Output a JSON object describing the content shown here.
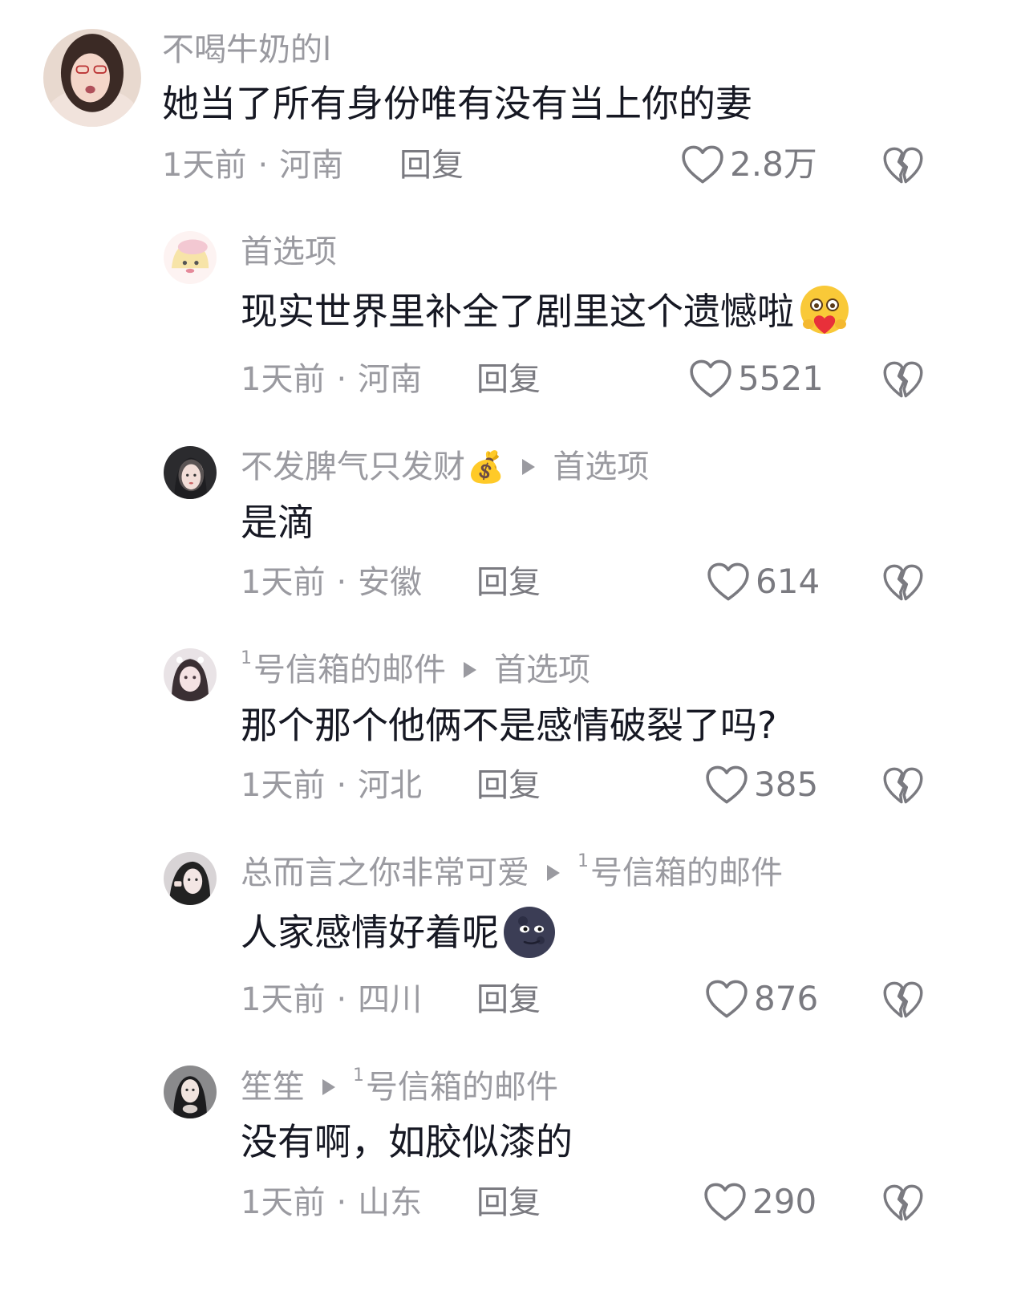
{
  "comments": [
    {
      "username": "不喝牛奶的l",
      "text": "她当了所有身份唯有没有当上你的妻",
      "time": "1天前",
      "dot": "·",
      "location": "河南",
      "reply_label": "回复",
      "likes": "2.8万"
    },
    {
      "username": "首选项",
      "text": "现实世界里补全了剧里这个遗憾啦",
      "text_emoji": "hugging-face-emoji",
      "time": "1天前",
      "dot": "·",
      "location": "河南",
      "reply_label": "回复",
      "likes": "5521"
    },
    {
      "username": "不发脾气只发财",
      "username_emoji": "💰",
      "reply_to": "首选项",
      "text": "是滴",
      "time": "1天前",
      "dot": "·",
      "location": "安徽",
      "reply_label": "回复",
      "likes": "614"
    },
    {
      "username_sup": "1",
      "username": "号信箱的邮件",
      "reply_to": "首选项",
      "text": "那个那个他俩不是感情破裂了吗?",
      "time": "1天前",
      "dot": "·",
      "location": "河北",
      "reply_label": "回复",
      "likes": "385"
    },
    {
      "username": "总而言之你非常可爱",
      "reply_to_sup": "1",
      "reply_to": "号信箱的邮件",
      "text": "人家感情好着呢",
      "text_emoji": "new-moon-face-emoji",
      "time": "1天前",
      "dot": "·",
      "location": "四川",
      "reply_label": "回复",
      "likes": "876"
    },
    {
      "username": "笙笙",
      "reply_to_sup": "1",
      "reply_to": "号信箱的邮件",
      "text": "没有啊，如胶似漆的",
      "time": "1天前",
      "dot": "·",
      "location": "山东",
      "reply_label": "回复",
      "likes": "290"
    }
  ],
  "icons": {
    "like": "heart-outline-icon",
    "dislike": "broken-heart-icon",
    "reply_arrow": "play-triangle-icon"
  },
  "colors": {
    "text": "#161823",
    "secondary": "#9a9aa0",
    "icon": "#7a7a80"
  }
}
